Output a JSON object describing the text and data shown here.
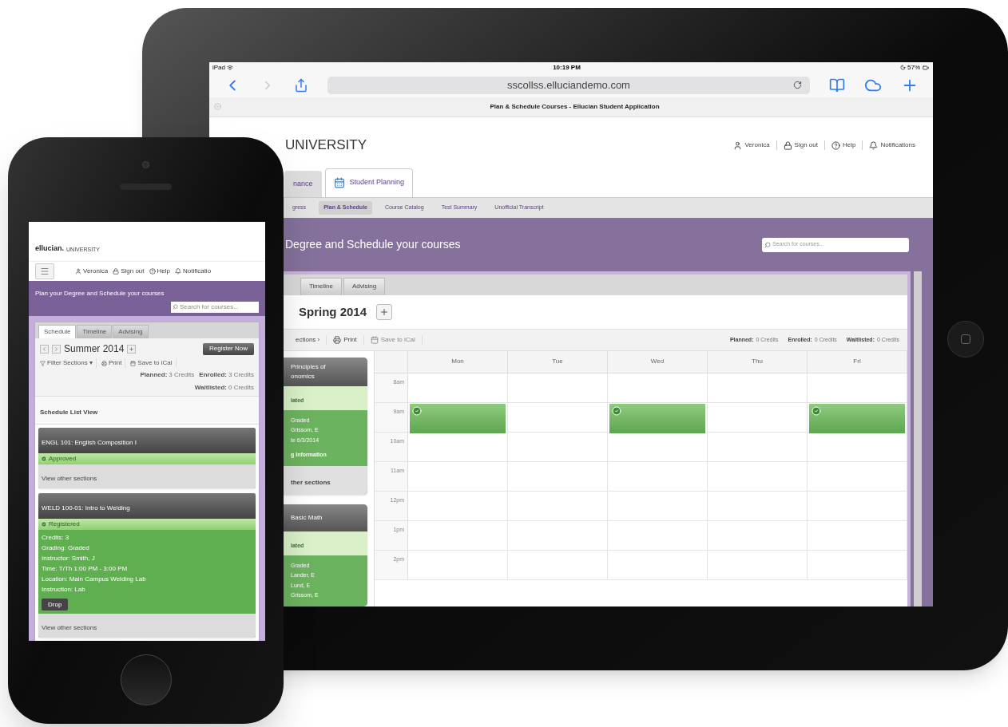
{
  "tablet": {
    "status_bar": {
      "carrier": "iPad",
      "time": "10:19 PM",
      "battery": "57%"
    },
    "address": "sscollss.elluciandemo.com",
    "page_title": "Plan & Schedule Courses - Ellucian Student Application",
    "brand": "UNIVERSITY",
    "user_links": [
      {
        "kind": "user",
        "label": "Veronica"
      },
      {
        "kind": "lock",
        "label": "Sign out"
      },
      {
        "kind": "help",
        "label": "Help"
      },
      {
        "kind": "bell",
        "label": "Notifications"
      }
    ],
    "main_tabs": [
      {
        "label": "nance",
        "selected": false
      },
      {
        "label": "Student Planning",
        "selected": true
      }
    ],
    "sub_nav": [
      {
        "label": "gress",
        "selected": false
      },
      {
        "label": "Plan & Schedule",
        "selected": true
      },
      {
        "label": "Course Catalog",
        "selected": false
      },
      {
        "label": "Test Summary",
        "selected": false
      },
      {
        "label": "Unofficial Transcript",
        "selected": false
      }
    ],
    "banner": "Degree and Schedule your courses",
    "search": {
      "placeholder": "Search for courses..."
    },
    "view_tabs": [
      {
        "label": "Timeline",
        "selected": false
      },
      {
        "label": "Advising",
        "selected": false
      }
    ],
    "term": "Spring 2014",
    "toolbar": [
      {
        "kind": "menu",
        "label": "ections ›"
      },
      {
        "kind": "print",
        "label": "Print"
      },
      {
        "kind": "calendar",
        "label": "Save to iCal"
      }
    ],
    "credits": [
      {
        "label": "Planned:",
        "value": "0 Credits"
      },
      {
        "label": "Enrolled:",
        "value": "0 Credits"
      },
      {
        "label": "Waitlisted:",
        "value": "0 Credits"
      }
    ],
    "course_cards": [
      {
        "title": [
          "Principles of",
          "onomics"
        ],
        "status": "lated",
        "details": [
          "Graded",
          "Grissom, E",
          "te 6/3/2014"
        ],
        "link": "g Information",
        "footer": "ther sections"
      },
      {
        "title": [
          "Basic Math"
        ],
        "status": "lated",
        "details": [
          "Graded",
          "Lander, E",
          "Lund, E",
          "Grissom, E"
        ]
      }
    ],
    "calendar": {
      "days": [
        "Mon",
        "Tue",
        "Wed",
        "Thu",
        "Fri"
      ],
      "rows": [
        {
          "time": "8am",
          "booked": [
            false,
            false,
            false,
            false,
            false
          ]
        },
        {
          "time": "9am",
          "booked": [
            true,
            false,
            true,
            false,
            true
          ]
        },
        {
          "time": "10am",
          "booked": [
            false,
            false,
            false,
            false,
            false
          ]
        },
        {
          "time": "11am",
          "booked": [
            false,
            false,
            false,
            false,
            false
          ]
        },
        {
          "time": "12pm",
          "booked": [
            false,
            false,
            false,
            false,
            false
          ]
        },
        {
          "time": "1pm",
          "booked": [
            false,
            false,
            false,
            false,
            false
          ]
        },
        {
          "time": "2pm",
          "booked": [
            false,
            false,
            false,
            false,
            false
          ]
        }
      ]
    }
  },
  "phone": {
    "logo": "ellucian.",
    "brand": "UNIVERSITY",
    "user_links": [
      {
        "kind": "user",
        "label": "Veronica"
      },
      {
        "kind": "lock",
        "label": "Sign out"
      },
      {
        "kind": "help",
        "label": "Help"
      },
      {
        "kind": "bell",
        "label": "Notificatio"
      }
    ],
    "banner": "Plan your Degree and Schedule your courses",
    "search": {
      "placeholder": "Search for courses..."
    },
    "tabs": [
      {
        "label": "Schedule",
        "selected": true
      },
      {
        "label": "Timeline",
        "selected": false
      },
      {
        "label": "Advising",
        "selected": false
      }
    ],
    "term": "Summer 2014",
    "register_button": "Register Now",
    "toolbar": [
      {
        "kind": "filter",
        "label": "Filter Sections ▾"
      },
      {
        "kind": "print",
        "label": "Print"
      },
      {
        "kind": "calendar",
        "label": "Save to iCal"
      }
    ],
    "credits": [
      {
        "label": "Planned:",
        "value": "3 Credits"
      },
      {
        "label": "Enrolled:",
        "value": "3 Credits"
      },
      {
        "label": "Waitlisted:",
        "value": "0 Credits"
      }
    ],
    "list_title": "Schedule List View",
    "cards": [
      {
        "title": "ENGL 101: English Composition I",
        "status": "Approved",
        "footer": "View other sections"
      },
      {
        "title": "WELD 100-01: Intro to Welding",
        "status": "Registered",
        "details": [
          "Credits: 3",
          "Grading: Graded",
          "Instructor: Smith, J",
          "Time: T/Th 1:00 PM - 3:00 PM",
          "Location: Main Campus Welding Lab",
          "Instruction: Lab"
        ],
        "button": "Drop",
        "footer": "View other sections"
      }
    ]
  }
}
